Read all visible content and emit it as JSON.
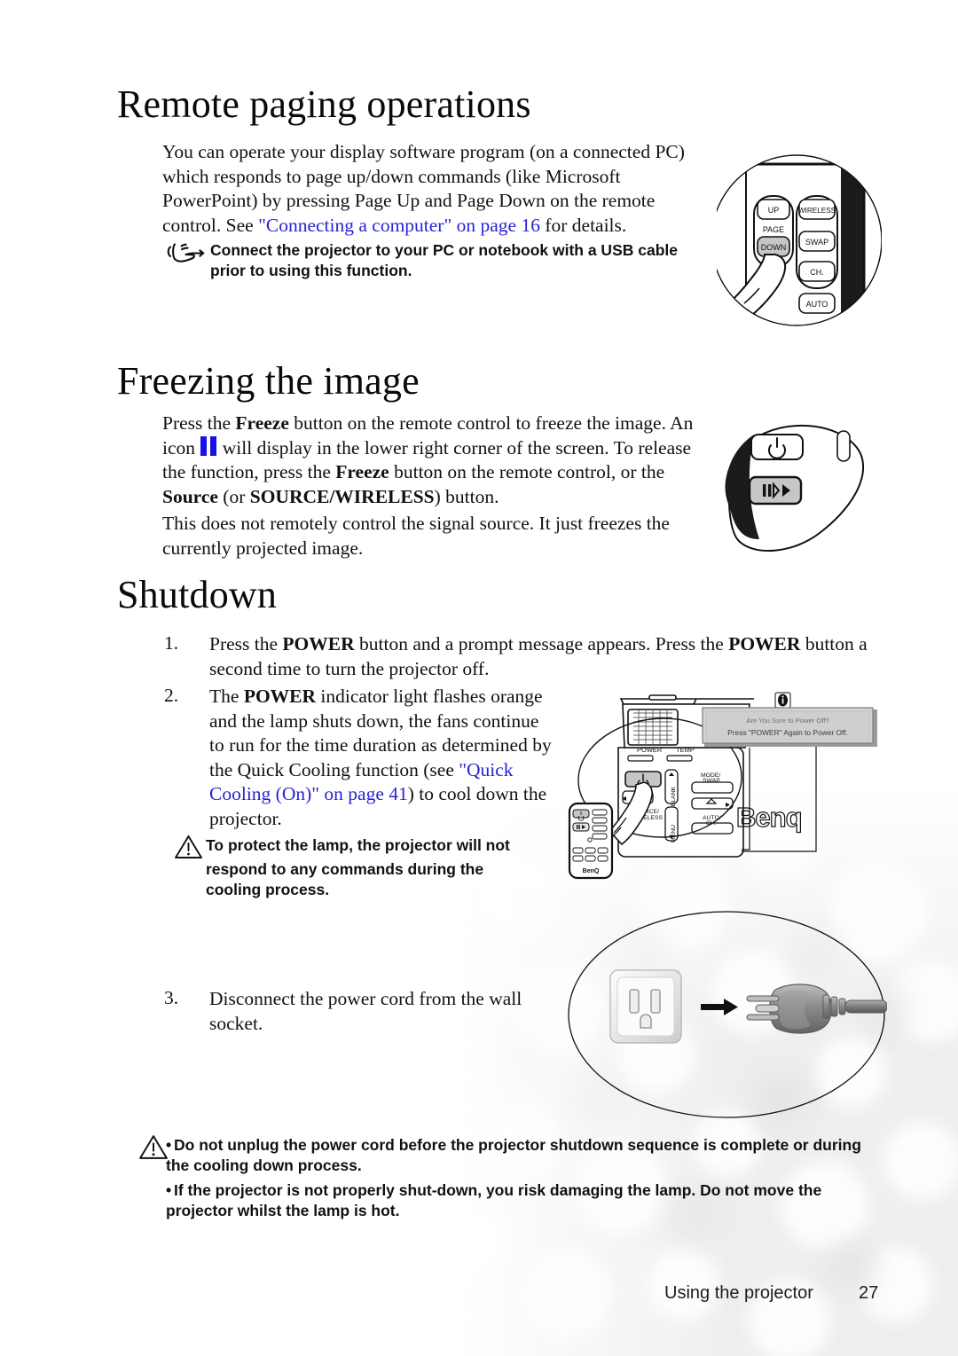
{
  "page": {
    "footer_chapter": "Using the projector",
    "footer_page_number": "27"
  },
  "sections": [
    {
      "id": "remote-paging",
      "heading": "Remote paging operations",
      "paragraph_parts": {
        "before_link": "You can operate your display software program (on a connected PC) which responds to page up/down commands (like Microsoft PowerPoint) by pressing Page Up and Page Down on the remote control. See ",
        "link": "\"Connecting a computer\" on page 16",
        "after_link": " for details."
      },
      "note": {
        "icon": "pointing-hand-icon",
        "text": "Connect the projector to your PC or notebook with a USB cable prior to using this function."
      }
    },
    {
      "id": "freezing-the-image",
      "heading": "Freezing the image",
      "paragraph1_parts": {
        "p1": "Press the ",
        "b1": "Freeze",
        "p2": " button on the remote control to freeze the image. An icon ",
        "icon": "freeze-pause-icon",
        "p3": " will display in the lower right corner of the screen. To release the function, press the ",
        "b2": "Freeze",
        "p4": " button on the remote control, or the ",
        "b3": "Source",
        "p5": " (or ",
        "b4": "SOURCE/WIRELESS",
        "p6": ") button."
      },
      "paragraph2": "This does not remotely control the signal source. It just freezes the currently projected image."
    },
    {
      "id": "shutdown",
      "heading": "Shutdown",
      "steps": [
        {
          "number": "1.",
          "parts": {
            "p1": "Press the ",
            "b1": "POWER",
            "p2": " button and a prompt message appears. Press the ",
            "b2": "POWER",
            "p3": " button a second time to turn the projector off."
          }
        },
        {
          "number": "2.",
          "parts": {
            "p1": "The ",
            "b1": "POWER",
            "p2": " indicator light flashes orange and the lamp shuts down, the fans continue to run for the time duration as determined by the Quick Cooling function (see ",
            "link": "\"Quick Cooling (On)\" on page 41",
            "p3": ") to cool down the projector."
          }
        },
        {
          "number": "3.",
          "parts": {
            "p1": "Disconnect the power cord from the wall socket."
          }
        }
      ],
      "caution": {
        "icon": "warning-triangle-icon",
        "line1": "To protect the lamp, the projector will not",
        "line2": "respond to any commands during the",
        "line3": "cooling process."
      },
      "bottom_warnings": {
        "icon": "warning-triangle-icon",
        "items": [
          "Do not unplug the power cord before the projector shutdown sequence is complete or during the cooling down process.",
          "If the projector is not properly shut-down, you risk damaging the lamp. Do not move the projector whilst the lamp is hot."
        ]
      }
    }
  ],
  "illustrations": {
    "remote_paging": {
      "name": "remote-control-page-buttons-illustration",
      "buttons": [
        "UP",
        "PAGE",
        "DOWN",
        "WIRELESS",
        "SWAP",
        "CH.",
        "AUTO"
      ],
      "pressed_button": "DOWN"
    },
    "freeze_remote": {
      "name": "remote-control-freeze-button-illustration",
      "buttons": [
        "power-icon",
        "II/▶"
      ],
      "pressed_button": "II/▶"
    },
    "projector_shutdown": {
      "name": "projector-power-off-illustration",
      "indicator_labels": [
        "POWER",
        "TEMP"
      ],
      "panel_labels": [
        "BLANK",
        "MENU",
        "MODE/ SWAP",
        "AUTO/ CH.",
        "SOURCE/ WIRELESS"
      ],
      "brand": "BenQ",
      "osd_message": {
        "line1": "Are You Sure to Power Off?",
        "line2": "Press \"POWER\" Again to Power Off."
      },
      "osd_icon": "info-icon"
    },
    "power_cord": {
      "name": "wall-socket-unplug-illustration",
      "arrow": "right-arrow-icon"
    }
  },
  "colors": {
    "link": "#2a22d6",
    "freeze_icon": "#1412e8",
    "text": "#111111",
    "button_fill": "#c8c8c8",
    "osd_fill": "#cfcfcf"
  }
}
